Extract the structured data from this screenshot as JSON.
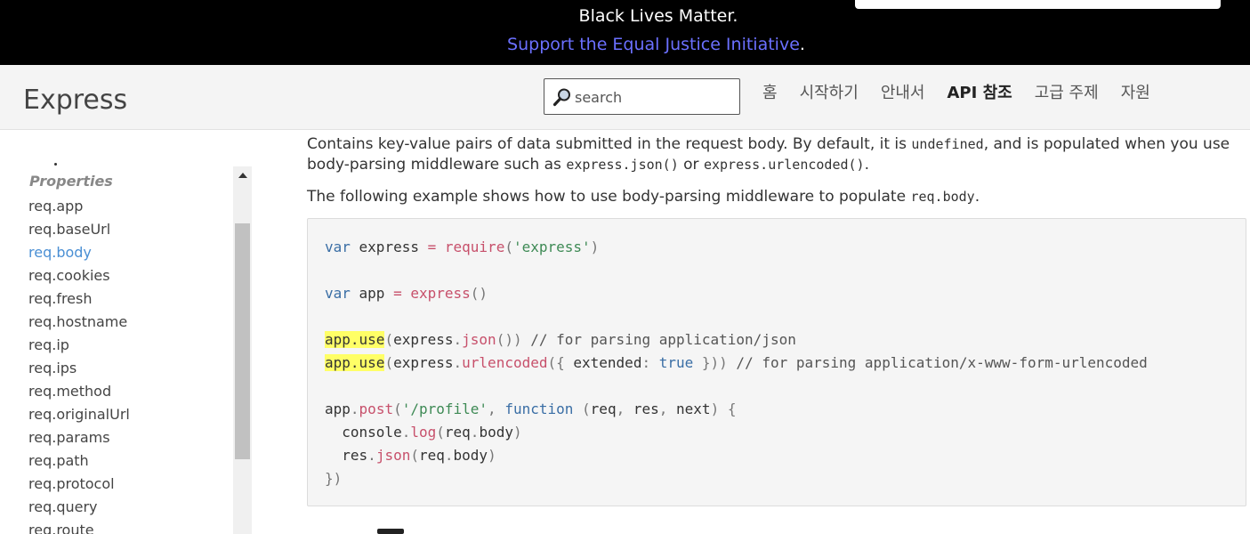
{
  "banner": {
    "line1": "Black Lives Matter.",
    "link": "Support the Equal Justice Initiative",
    "after": "."
  },
  "header": {
    "logo": "Express",
    "search_placeholder": "search",
    "nav": [
      "홈",
      "시작하기",
      "안내서",
      "API 참조",
      "고급 주제",
      "자원"
    ],
    "active_nav": "API 참조"
  },
  "sidebar": {
    "heading": "Properties",
    "items": [
      "req.app",
      "req.baseUrl",
      "req.body",
      "req.cookies",
      "req.fresh",
      "req.hostname",
      "req.ip",
      "req.ips",
      "req.method",
      "req.originalUrl",
      "req.params",
      "req.path",
      "req.protocol",
      "req.query",
      "req.route"
    ],
    "active_item": "req.body"
  },
  "content": {
    "p1_a": "Contains key-value pairs of data submitted in the request body. By default, it is ",
    "p1_code1": "undefined",
    "p1_b": ", and is populated when you use body-parsing middleware such as ",
    "p1_code2": "express.json()",
    "p1_c": " or ",
    "p1_code3": "express.urlencoded()",
    "p1_d": ".",
    "p2_a": "The following example shows how to use body-parsing middleware to populate ",
    "p2_code": "req.body",
    "p2_b": "."
  },
  "code": {
    "l1": {
      "kw": "var",
      "name": " express ",
      "op": "=",
      "sp": " ",
      "fn": "require",
      "p1": "(",
      "str": "'express'",
      "p2": ")"
    },
    "l2": {
      "kw": "var",
      "name": " app ",
      "op": "=",
      "sp": " ",
      "fn": "express",
      "p1": "()"
    },
    "l3": {
      "hl": "app.use",
      "p1": "(",
      "obj": "express",
      "dot": ".",
      "fn": "json",
      "p2": "())",
      "cm": " // for parsing application/json"
    },
    "l4": {
      "hl": "app.use",
      "p1": "(",
      "obj": "express",
      "dot": ".",
      "fn": "urlencoded",
      "p2": "({",
      "key": " extended",
      "colon": ":",
      "bool": " true",
      "p3": " }))",
      "cm": " // for parsing application/x-www-form-urlencoded"
    },
    "l5": {
      "obj": "app",
      "dot": ".",
      "fn": "post",
      "p1": "(",
      "str": "'/profile'",
      "comma": ",",
      "kw": " function",
      "sp": " ",
      "p2": "(",
      "a1": "req",
      "c1": ",",
      "a2": " res",
      "c2": ",",
      "a3": " next",
      "p3": ")",
      "p4": " {"
    },
    "l6": {
      "indent": "  ",
      "obj": "console",
      "dot": ".",
      "fn": "log",
      "p1": "(",
      "a": "req",
      "dot2": ".",
      "b": "body",
      "p2": ")"
    },
    "l7": {
      "indent": "  ",
      "obj": "res",
      "dot": ".",
      "fn": "json",
      "p1": "(",
      "a": "req",
      "dot2": ".",
      "b": "body",
      "p2": ")"
    },
    "l8": {
      "p": "})"
    }
  },
  "colors": {
    "banner_bg": "#000000",
    "banner_link": "#6b70ff",
    "active_link": "#4a8fd4",
    "highlight": "#ffff66"
  }
}
